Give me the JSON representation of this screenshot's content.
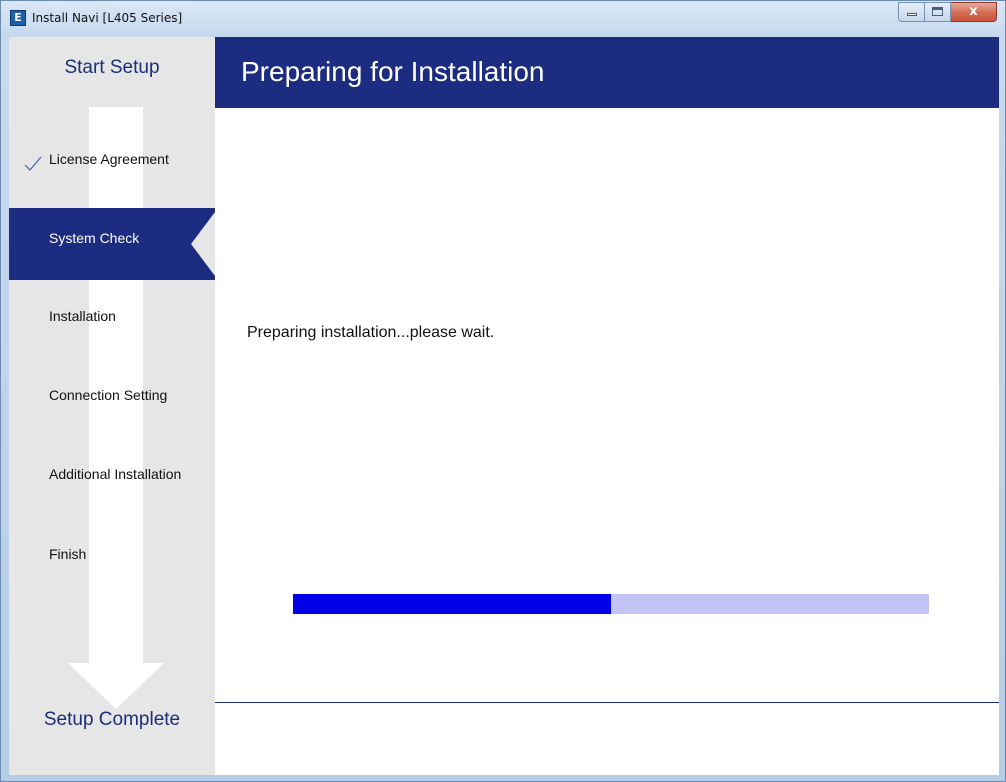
{
  "window": {
    "title": "Install Navi [L405 Series]",
    "icon_letter": "E",
    "controls": {
      "close_glyph": "x"
    }
  },
  "sidebar": {
    "start_label": "Start Setup",
    "complete_label": "Setup Complete",
    "steps": [
      {
        "label": "License Agreement",
        "state": "done"
      },
      {
        "label": "System Check",
        "state": "active"
      },
      {
        "label": "Installation",
        "state": "pending"
      },
      {
        "label": "Connection Setting",
        "state": "pending"
      },
      {
        "label": "Additional Installation",
        "state": "pending"
      },
      {
        "label": "Finish",
        "state": "pending"
      }
    ]
  },
  "main": {
    "title": "Preparing for Installation",
    "status": "Preparing installation...please wait.",
    "progress": 0.5
  },
  "colors": {
    "header": "#1c2c80",
    "active_step": "#1c2c80",
    "progress_fill": "#0000e6",
    "progress_track": "#c3c3f5",
    "sidebar": "#e6e6e6"
  },
  "icons": {
    "app": "epson-app-icon",
    "check": "checkmark-icon",
    "flow": "down-arrow-icon"
  }
}
